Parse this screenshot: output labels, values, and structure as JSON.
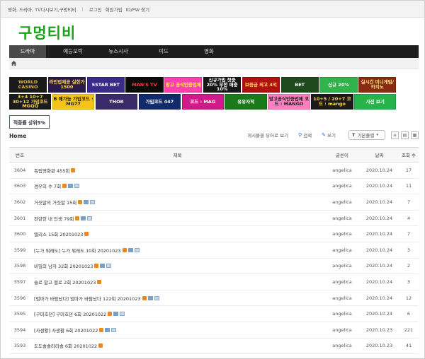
{
  "topbar": {
    "site_tagline": "영화, 드라마, TV다시보기,구멍티비",
    "links": [
      "로그인",
      "회원가입",
      "ID/PW 찾기"
    ]
  },
  "logo": "구멍티비",
  "nav": [
    "드라마",
    "예능오락",
    "뉴스시사",
    "미드",
    "영화"
  ],
  "banners": [
    [
      {
        "text": "WORLD CASINO",
        "bg": "#1a1a1a",
        "fg": "#d9b24a"
      },
      {
        "text": "라인업제공 실한가 1500",
        "bg": "#2b1a4a",
        "fg": "#ffd84a"
      },
      {
        "text": "5STAR BET",
        "bg": "#3a2a8a",
        "fg": "#ffffff"
      },
      {
        "text": "MAN'S TV",
        "bg": "#0b0b0b",
        "fg": "#ff3a3a"
      },
      {
        "text": "망고 공식인증업체",
        "bg": "#ff3fb0",
        "fg": "#fff04a"
      },
      {
        "text": "신규가입 첫충 20% 무한 매충 10%",
        "bg": "#161616",
        "fg": "#ffffff"
      },
      {
        "text": "보증금 최고 4억",
        "bg": "#b01010",
        "fg": "#ffe04a"
      },
      {
        "text": "BET",
        "bg": "#1e4a1e",
        "fg": "#ffffff"
      },
      {
        "text": "신규 20%",
        "bg": "#2fb34a",
        "fg": "#ffffff"
      },
      {
        "text": "실시간 미니게임/카지노",
        "bg": "#8a2a10",
        "fg": "#ffe08a"
      }
    ],
    [
      {
        "text": "3+4 10+7 30+12 가입코드 MGQQ",
        "bg": "#1a1a1a",
        "fg": "#ffd84a"
      },
      {
        "text": "B 배가능 가입코드 : MG77",
        "bg": "#f4c41a",
        "fg": "#1a1a1a"
      },
      {
        "text": "THOR",
        "bg": "#3a2a6a",
        "fg": "#ffffff"
      },
      {
        "text": "가입코드 447",
        "bg": "#102a6a",
        "fg": "#ffffff"
      },
      {
        "text": "코드 : MAG",
        "bg": "#d01a8a",
        "fg": "#ffffff"
      },
      {
        "text": "유유자적",
        "bg": "#1a7a1a",
        "fg": "#ffffff"
      },
      {
        "text": "망고공식인증업체 코드 : MANGO",
        "bg": "#ff7fc0",
        "fg": "#1a1a1a"
      },
      {
        "text": "10+5 / 20+7 코드 : mango",
        "bg": "#1a1a1a",
        "fg": "#ffd84a"
      },
      {
        "text": "사진 보기",
        "bg": "#26b44a",
        "fg": "#ffffff"
      }
    ]
  ],
  "rate_box": "적중률 상위5%",
  "board": {
    "home_label": "Home",
    "toolbar": {
      "rss": "게시물을 뷰어로 보기",
      "search": "검색",
      "write": "쓰기",
      "sort": "기본졸렬"
    },
    "columns": {
      "num": "번호",
      "title": "제목",
      "writer": "글쓴이",
      "date": "날짜",
      "views": "조회 수"
    },
    "rows": [
      {
        "num": "3604",
        "title": "독립영화관 455회",
        "writer": "angelica",
        "date": "2020.10.24",
        "views": "17",
        "badges": [
          "new"
        ]
      },
      {
        "num": "3603",
        "title": "경우의 수 7회",
        "writer": "angelica",
        "date": "2020.10.24",
        "views": "11",
        "badges": [
          "new",
          "file",
          "img"
        ]
      },
      {
        "num": "3602",
        "title": "거짓말의 거짓말 15회",
        "writer": "angelica",
        "date": "2020.10.24",
        "views": "7",
        "badges": [
          "new",
          "file",
          "img"
        ]
      },
      {
        "num": "3601",
        "title": "찬란한 내 인생 79회",
        "writer": "angelica",
        "date": "2020.10.24",
        "views": "4",
        "badges": [
          "new",
          "file",
          "img"
        ]
      },
      {
        "num": "3600",
        "title": "앨리스 15회 20201023",
        "writer": "angelica",
        "date": "2020.10.24",
        "views": "7",
        "badges": [
          "new"
        ]
      },
      {
        "num": "3599",
        "title": "[누가 뭐래도] 누가 뭐래도 10회 20201023",
        "writer": "angelica",
        "date": "2020.10.24",
        "views": "3",
        "badges": [
          "new",
          "file",
          "img"
        ]
      },
      {
        "num": "3598",
        "title": "비밀의 남자 32회 20201023",
        "writer": "angelica",
        "date": "2020.10.24",
        "views": "2",
        "badges": [
          "new",
          "file",
          "img"
        ]
      },
      {
        "num": "3597",
        "title": "슬로 말고 멜로 2회 20201023",
        "writer": "angelica",
        "date": "2020.10.24",
        "views": "3",
        "badges": [
          "new"
        ]
      },
      {
        "num": "3596",
        "title": "[엄마가 바람났다] 엄마가 바람났다 122회 20201023",
        "writer": "angelica",
        "date": "2020.10.24",
        "views": "12",
        "badges": [
          "new",
          "file",
          "img"
        ]
      },
      {
        "num": "3595",
        "title": "[구미호뎐] 구미호뎐 6회 20201022",
        "writer": "angelica",
        "date": "2020.10.24",
        "views": "6",
        "badges": [
          "new",
          "file",
          "img"
        ]
      },
      {
        "num": "3594",
        "title": "[사생활] 사생활 6회 20201022",
        "writer": "angelica",
        "date": "2020.10.23",
        "views": "221",
        "badges": [
          "new",
          "file",
          "img"
        ]
      },
      {
        "num": "3593",
        "title": "도도솔솔라라솔 6회 20201022",
        "writer": "angelica",
        "date": "2020.10.23",
        "views": "41",
        "badges": [
          "new"
        ]
      },
      {
        "num": "3592",
        "title": "나를 사랑한 스파이 2회 20201022",
        "writer": "angelica",
        "date": "2020.10.23",
        "views": "20",
        "badges": [
          "new"
        ]
      }
    ]
  },
  "colors": {
    "logo": "#19a319",
    "nav_bg": "#1d1d1d",
    "rate_border": "#dd2222"
  }
}
